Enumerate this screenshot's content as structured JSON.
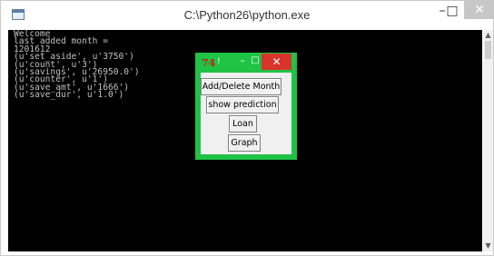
{
  "window": {
    "title": "C:\\Python26\\python.exe",
    "minimize_glyph": "–",
    "maximize_glyph": "□",
    "close_glyph": "✕"
  },
  "console": {
    "lines": "Welcome\nlast added month =\n1201612\n(u'set_aside', u'3750')\n(u'count', u'3')\n(u'savings', u'26950.0')\n(u'counter', u'1')\n(u'save_amt', u'1666')\n(u'save_dur', u'1.0')"
  },
  "scrollbar": {
    "up_glyph": "▲",
    "down_glyph": "▼"
  },
  "tk_dialog": {
    "icon_glyph": "74",
    "title": "!",
    "minimize_glyph": "–",
    "maximize_glyph": "□",
    "close_glyph": "✕",
    "buttons": {
      "add_delete": "Add/Delete Month",
      "show_prediction": "show prediction",
      "loan": "Loan",
      "graph": "Graph"
    },
    "accent_color": "#1fc345",
    "close_color": "#d9342b"
  }
}
